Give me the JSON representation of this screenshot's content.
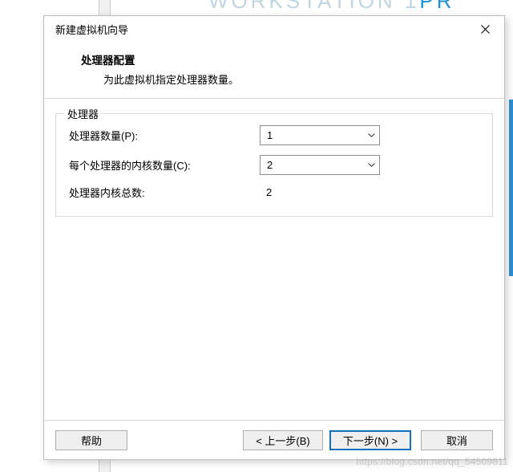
{
  "background": {
    "partial_text_left": "WORKSTATION 1",
    "partial_text_right": "PR"
  },
  "dialog": {
    "title": "新建虚拟机向导",
    "header": {
      "title": "处理器配置",
      "subtitle": "为此虚拟机指定处理器数量。"
    },
    "fieldset": {
      "legend": "处理器",
      "rows": {
        "processors": {
          "label": "处理器数量(P):",
          "value": "1"
        },
        "cores": {
          "label": "每个处理器的内核数量(C):",
          "value": "2"
        },
        "total": {
          "label": "处理器内核总数:",
          "value": "2"
        }
      }
    },
    "buttons": {
      "help": "帮助",
      "back": "< 上一步(B)",
      "next": "下一步(N) >",
      "cancel": "取消"
    }
  },
  "watermark": "https://blog.csdn.net/qq_54509811"
}
